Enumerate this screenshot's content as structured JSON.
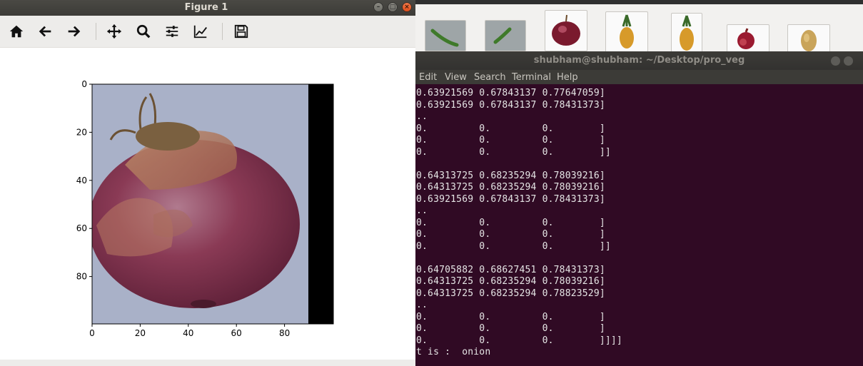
{
  "figure": {
    "title": "Figure 1",
    "window_buttons": [
      "–",
      "□",
      "×"
    ],
    "toolbar": [
      "home-icon",
      "back-arrow-icon",
      "forward-arrow-icon",
      "pan-icon",
      "zoom-icon",
      "subplots-icon",
      "edit-axes-icon",
      "save-icon"
    ],
    "plot": {
      "y_ticks": [
        "0",
        "20",
        "40",
        "60",
        "80"
      ],
      "x_ticks": [
        "0",
        "20",
        "40",
        "60",
        "80"
      ],
      "image_subject": "red onion",
      "colors": {
        "onion_skin": "#8a3a55",
        "background": "#a9b1c8",
        "padding": "#000000"
      }
    }
  },
  "thumbnails": [
    {
      "name": "green-chili-thumb",
      "subject": "green chili"
    },
    {
      "name": "green-chili-2-thumb",
      "subject": "green chili"
    },
    {
      "name": "red-onion-thumb",
      "subject": "red onion"
    },
    {
      "name": "pineapple-thumb",
      "subject": "pineapple"
    },
    {
      "name": "pineapple-2-thumb",
      "subject": "pineapple"
    },
    {
      "name": "pomegranate-thumb",
      "subject": "pomegranate"
    },
    {
      "name": "potato-thumb",
      "subject": "potato"
    }
  ],
  "terminal": {
    "title": "shubham@shubham: ~/Desktop/pro_veg",
    "menu": [
      "Edit",
      "View",
      "Search",
      "Terminal",
      "Help"
    ],
    "lines": [
      "0.63921569 0.67843137 0.77647059]",
      "0.63921569 0.67843137 0.78431373]",
      "..",
      "0.         0.         0.        ]",
      "0.         0.         0.        ]",
      "0.         0.         0.        ]]",
      "",
      "0.64313725 0.68235294 0.78039216]",
      "0.64313725 0.68235294 0.78039216]",
      "0.63921569 0.67843137 0.78431373]",
      "..",
      "0.         0.         0.        ]",
      "0.         0.         0.        ]",
      "0.         0.         0.        ]]",
      "",
      "0.64705882 0.68627451 0.78431373]",
      "0.64313725 0.68235294 0.78039216]",
      "0.64313725 0.68235294 0.78823529]",
      "..",
      "0.         0.         0.        ]",
      "0.         0.         0.        ]",
      "0.         0.         0.        ]]]]",
      "t is :  onion"
    ],
    "colors": {
      "background": "#300a24",
      "text": "#e5e5e5"
    }
  }
}
